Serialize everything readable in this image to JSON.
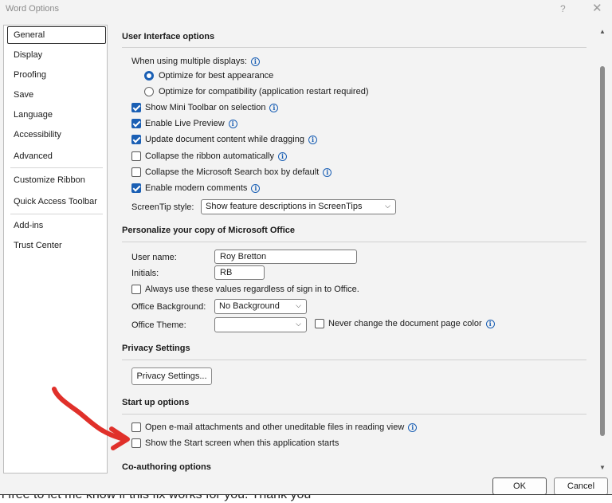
{
  "window": {
    "title": "Word Options",
    "help": "?",
    "close": "✕"
  },
  "nav": {
    "items": [
      "General",
      "Display",
      "Proofing",
      "Save",
      "Language",
      "Accessibility",
      "Advanced",
      "Customize Ribbon",
      "Quick Access Toolbar",
      "Add-ins",
      "Trust Center"
    ],
    "active": "General"
  },
  "ui_options": {
    "heading": "User Interface options",
    "multi_display_label": "When using multiple displays:",
    "radio_best": "Optimize for best appearance",
    "radio_compat": "Optimize for compatibility (application restart required)",
    "mini_toolbar": "Show Mini Toolbar on selection",
    "live_preview": "Enable Live Preview",
    "update_dragging": "Update document content while dragging",
    "collapse_ribbon": "Collapse the ribbon automatically",
    "collapse_search": "Collapse the Microsoft Search box by default",
    "modern_comments": "Enable modern comments",
    "screentip_label": "ScreenTip style:",
    "screentip_value": "Show feature descriptions in ScreenTips"
  },
  "personalize": {
    "heading": "Personalize your copy of Microsoft Office",
    "username_label": "User name:",
    "username_value": "Roy Bretton",
    "initials_label": "Initials:",
    "initials_value": "RB",
    "always_use": "Always use these values regardless of sign in to Office.",
    "background_label": "Office Background:",
    "background_value": "No Background",
    "theme_label": "Office Theme:",
    "theme_value": "",
    "never_change": "Never change the document page color"
  },
  "privacy": {
    "heading": "Privacy Settings",
    "button": "Privacy Settings..."
  },
  "startup": {
    "heading": "Start up options",
    "open_attachments": "Open e-mail attachments and other uneditable files in reading view",
    "show_start": "Show the Start screen when this application starts"
  },
  "coauthoring": {
    "heading": "Co-authoring options"
  },
  "footer": {
    "ok": "OK",
    "cancel": "Cancel"
  },
  "background_text": "l free to let me know if this fix works for you. Thank you",
  "colors": {
    "accent": "#1a5fb4",
    "annotation_arrow": "#e0302a"
  },
  "icons": {
    "info": "info-icon",
    "chevron": "chevron-down-icon"
  }
}
